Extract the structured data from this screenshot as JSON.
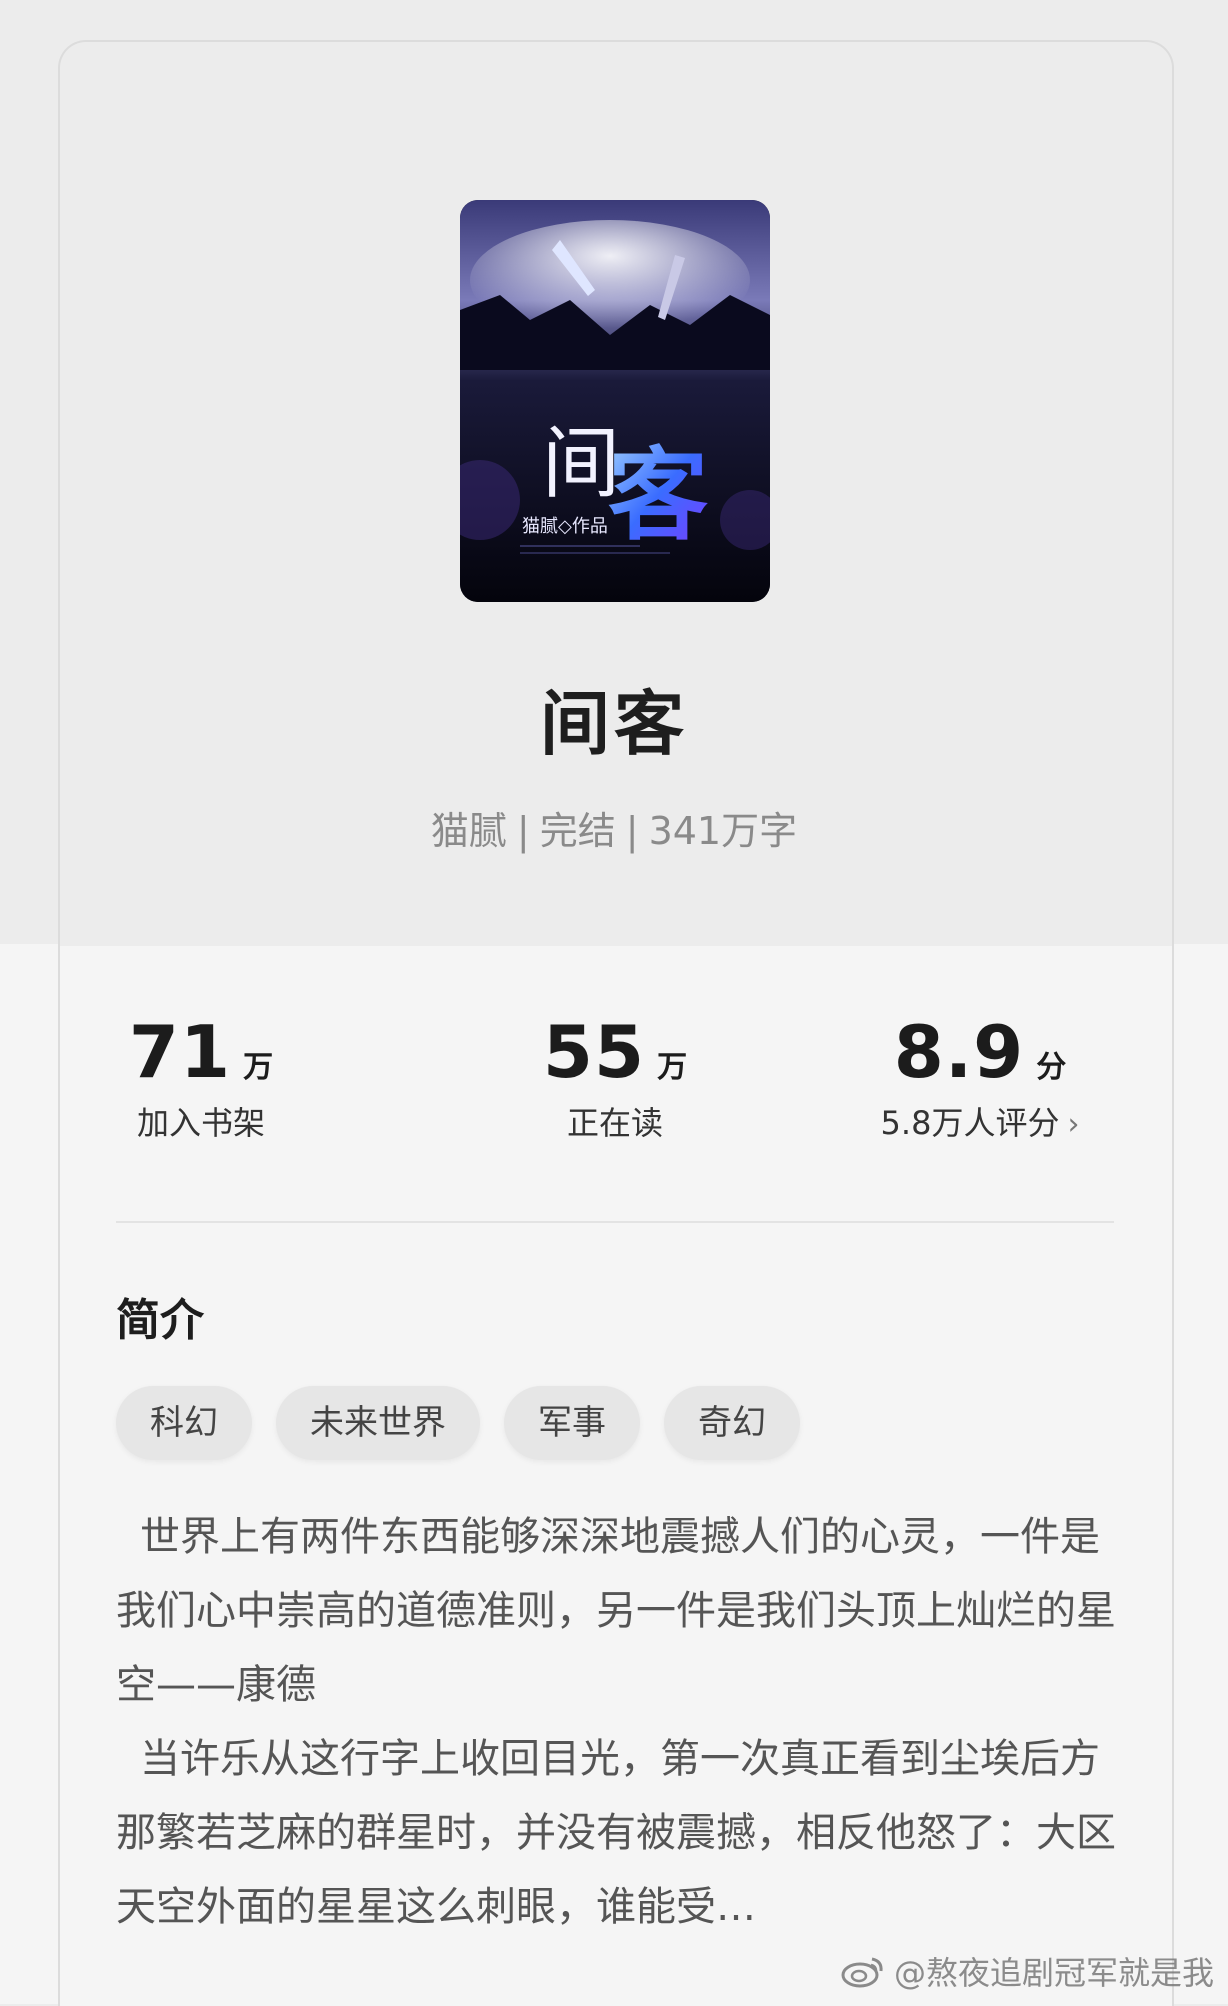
{
  "book": {
    "title": "间客",
    "author": "猫腻",
    "status": "完结",
    "word_count": "341万字",
    "cover_title": "间客",
    "cover_byline": "猫腻◇作品"
  },
  "stats": {
    "shelf": {
      "value": "71",
      "unit": "万",
      "label": "加入书架"
    },
    "reading": {
      "value": "55",
      "unit": "万",
      "label": "正在读"
    },
    "rating": {
      "value": "8.9",
      "unit": "分",
      "label": "5.8万人评分"
    }
  },
  "intro": {
    "heading": "简介",
    "tags": [
      "科幻",
      "未来世界",
      "军事",
      "奇幻"
    ],
    "paragraph1": "世界上有两件东西能够深深地震撼人们的心灵，一件是我们心中崇高的道德准则，另一件是我们头顶上灿烂的星空——康德",
    "paragraph2": "当许乐从这行字上收回目光，第一次真正看到尘埃后方那繁若芝麻的群星时，并没有被震撼，相反他怒了：大区天空外面的星星这么刺眼，谁能受…"
  },
  "watermark": {
    "text": "@熬夜追剧冠军就是我",
    "icon": "weibo-icon"
  }
}
